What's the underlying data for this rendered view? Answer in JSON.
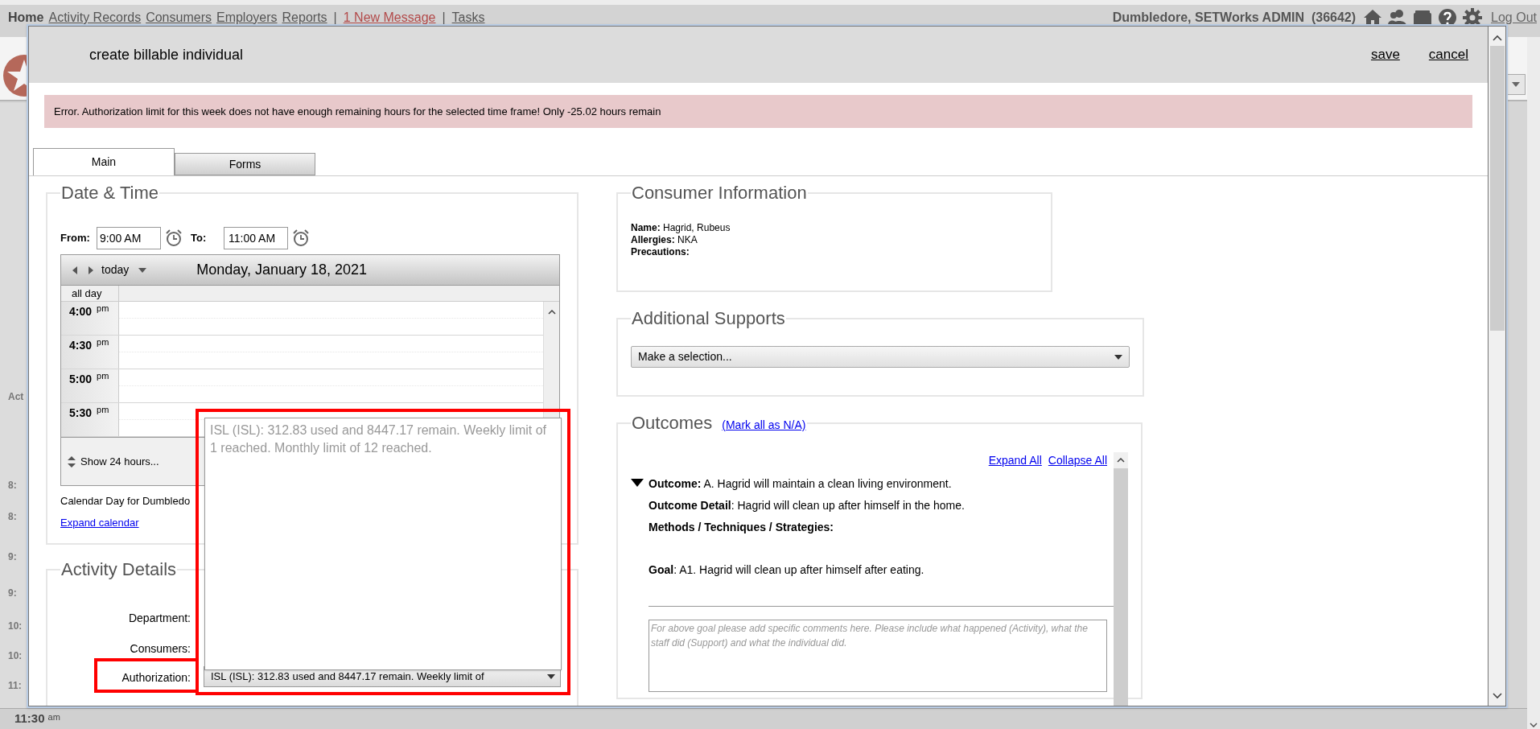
{
  "top_nav": {
    "items": [
      {
        "label": "Home",
        "kind": "current"
      },
      {
        "label": "Activity Records",
        "kind": "link"
      },
      {
        "label": "Consumers",
        "kind": "link"
      },
      {
        "label": "Employers",
        "kind": "link"
      },
      {
        "label": "Reports",
        "kind": "link"
      },
      {
        "label": "|",
        "kind": "separator"
      },
      {
        "label": "1 New Message",
        "kind": "alert"
      },
      {
        "label": "|",
        "kind": "separator"
      },
      {
        "label": "Tasks",
        "kind": "link"
      }
    ],
    "user": "Dumbledore, SETWorks ADMIN  (36642)",
    "logout": "Log Out"
  },
  "background_page": {
    "side_labels": [
      "Act",
      "8:",
      "8:",
      "9:",
      "9:",
      "10:",
      "10:",
      "11:"
    ],
    "bottom_time": "11:30",
    "bottom_ampm": "am"
  },
  "dialog": {
    "title": "create billable individual",
    "actions": [
      "save",
      "cancel"
    ],
    "error": "Error. Authorization limit for this week does not have enough remaining hours for the selected time frame! Only -25.02 hours remain",
    "tabs": [
      {
        "label": "Main",
        "selected": true
      },
      {
        "label": "Forms",
        "selected": false
      }
    ],
    "date_time": {
      "title": "Date & Time",
      "from_label": "From:",
      "from_value": "9:00 AM",
      "to_label": "To:",
      "to_value": "11:00 AM",
      "calendar": {
        "nav_label": "today",
        "date": "Monday, January 18, 2021",
        "all_day": "all day",
        "slots": [
          {
            "time": "4:00",
            "ampm": "pm"
          },
          {
            "time": "4:30",
            "ampm": "pm"
          },
          {
            "time": "5:00",
            "ampm": "pm"
          },
          {
            "time": "5:30",
            "ampm": "pm"
          }
        ],
        "show_more": "Show 24 hours..."
      },
      "caption": "Calendar Day for Dumbledo",
      "expand_link": "Expand calendar"
    },
    "activity_details": {
      "title": "Activity Details",
      "fields": [
        {
          "label": "Department:",
          "highlighted": false
        },
        {
          "label": "Consumers:",
          "highlighted": false
        },
        {
          "label": "Authorization:",
          "highlighted": true,
          "value": "ISL (ISL): 312.83 used and 8447.17 remain. Weekly limit of"
        }
      ]
    },
    "authorization_dropdown": {
      "expanded": true,
      "highlighted": true,
      "options": [
        "ISL (ISL): 312.83 used and 8447.17 remain. Weekly limit of 1 reached. Monthly limit of 12 reached."
      ]
    },
    "consumer_info": {
      "title": "Consumer Information",
      "lines": [
        "**Name:** Hagrid, Rubeus",
        "**Allergies:** NKA",
        "**Precautions:**"
      ]
    },
    "additional_supports": {
      "title": "Additional Supports",
      "select_placeholder": "Make a selection..."
    },
    "outcomes": {
      "title": "Outcomes",
      "mark_all": "(Mark all as N/A)",
      "expand_all": "Expand All",
      "collapse_all": "Collapse All",
      "items": [
        {
          "expanded": true,
          "lines": [
            "**Outcome:** A. Hagrid will maintain a clean living environment.",
            "**Outcome Detail**: Hagrid will clean up after himself in the home.",
            "**Methods / Techniques / Strategies:**"
          ],
          "goal": "**Goal**: A1. Hagrid will clean up after himself after eating.",
          "comment_placeholder": "For above goal please add specific comments here. Please include what happened (Activity), what the staff did (Support) and what the individual did."
        }
      ]
    }
  }
}
